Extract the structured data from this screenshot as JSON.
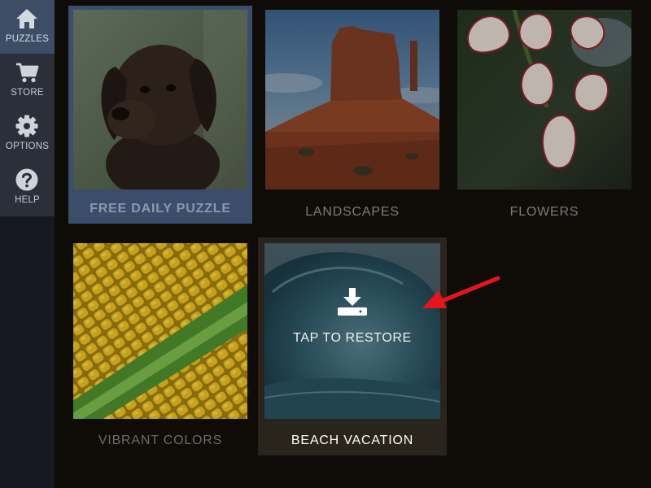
{
  "sidebar": {
    "items": [
      {
        "label": "PUZZLES",
        "icon": "home-icon",
        "active": true
      },
      {
        "label": "STORE",
        "icon": "cart-icon",
        "active": false
      },
      {
        "label": "OPTIONS",
        "icon": "gear-icon",
        "active": false
      },
      {
        "label": "HELP",
        "icon": "help-icon",
        "active": false
      }
    ]
  },
  "tiles": [
    {
      "label": "FREE DAILY PUZZLE",
      "image": "puppy",
      "highlighted": true
    },
    {
      "label": "LANDSCAPES",
      "image": "desert-butte"
    },
    {
      "label": "FLOWERS",
      "image": "flowers"
    },
    {
      "label": "VIBRANT COLORS",
      "image": "corn"
    },
    {
      "label": "BEACH VACATION",
      "image": "wave",
      "overlay_icon": "download-icon",
      "overlay_label": "TAP TO RESTORE"
    }
  ],
  "annotation": {
    "type": "arrow",
    "color": "#e8141b"
  },
  "colors": {
    "background": "#0f0c08",
    "sidebar": "#171922",
    "sidebar_active": "#3d4d66",
    "daily_highlight": "#3a4d6a",
    "caption_muted": "#7b7b7b"
  }
}
